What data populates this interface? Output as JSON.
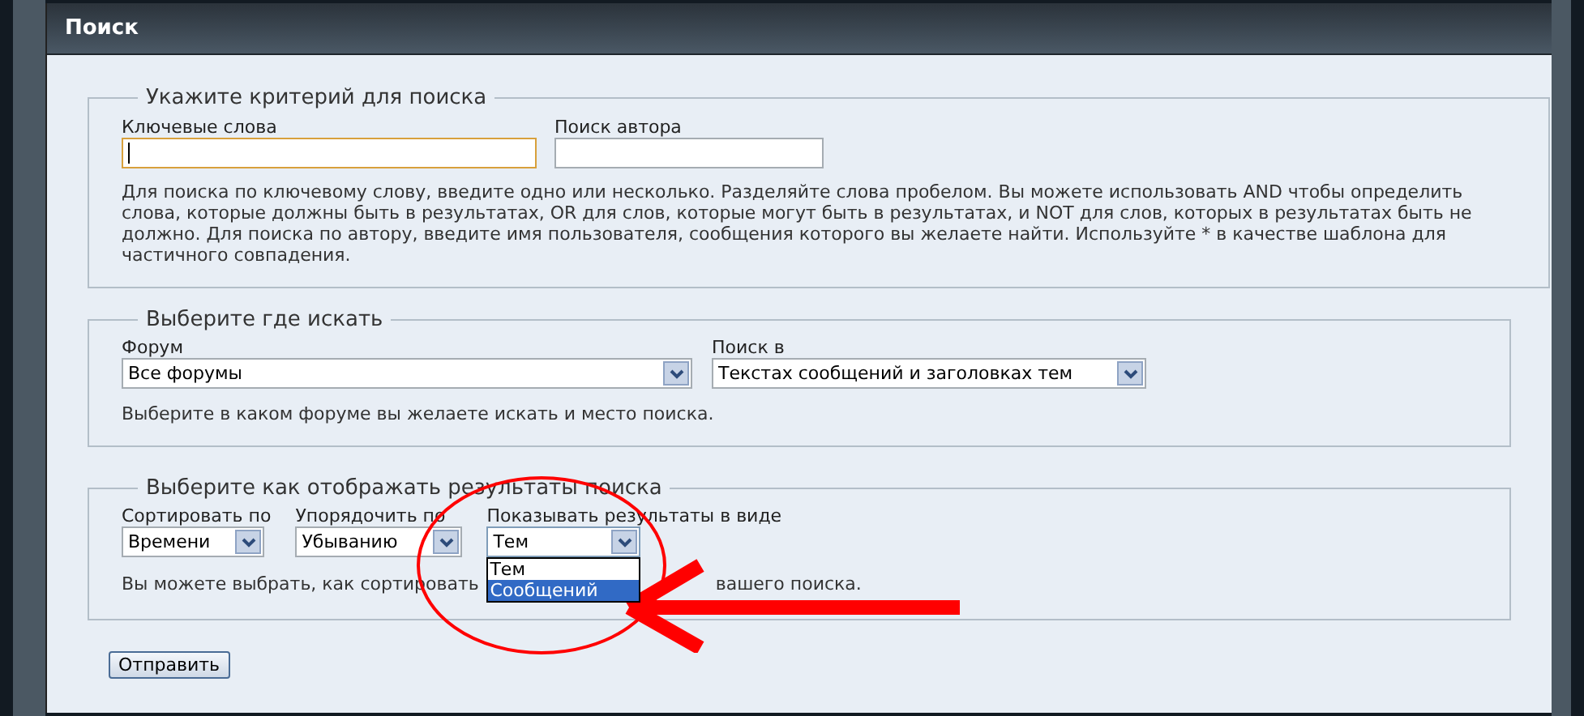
{
  "window": {
    "title": "Поиск"
  },
  "criteria": {
    "legend": "Укажите критерий для поиска",
    "keywords": {
      "label": "Ключевые слова",
      "focused": true
    },
    "author": {
      "label": "Поиск автора"
    },
    "hint": "Для поиска по ключевому слову, введите одно или несколько. Разделяйте слова пробелом. Вы можете использовать AND чтобы определить слова, которые должны быть в результатах, OR для слов, которые могут быть в результатах, и NOT для слов, которых в результатах быть не должно. Для поиска по автору, введите имя пользователя, сообщения которого вы желаете найти. Используйте * в качестве шаблона для частичного совпадения."
  },
  "where": {
    "legend": "Выберите где искать",
    "forum": {
      "label": "Форум",
      "value": "Все форумы"
    },
    "search_in": {
      "label": "Поиск в",
      "value": "Текстах сообщений и заголовках тем"
    },
    "hint": "Выберите в каком форуме вы желаете искать и место поиска."
  },
  "display": {
    "legend": "Выберите как отображать результаты поиска",
    "sort_by": {
      "label": "Сортировать по",
      "value": "Времени"
    },
    "order": {
      "label": "Упорядочить по",
      "value": "Убыванию"
    },
    "show_as": {
      "label": "Показывать результаты в виде",
      "value": "Тем",
      "expanded": true,
      "options": [
        {
          "label": "Тем",
          "highlighted": false
        },
        {
          "label": "Сообщений",
          "highlighted": true
        }
      ]
    },
    "hint_start": "Вы можете выбрать, как сортировать",
    "hint_end": "вашего поиска."
  },
  "submit": "Отправить"
}
